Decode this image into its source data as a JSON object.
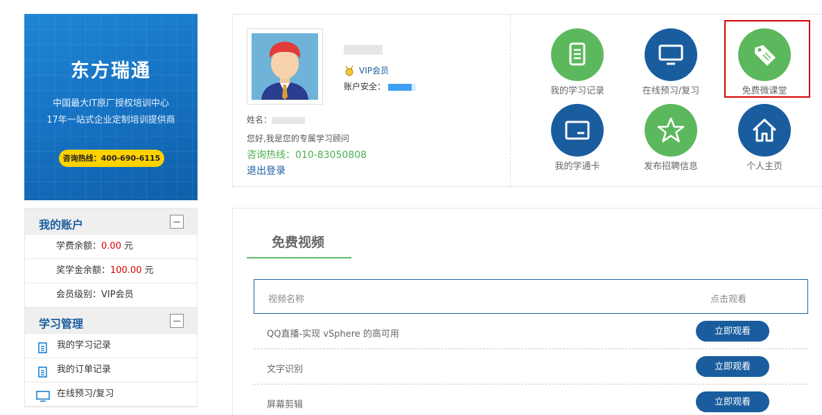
{
  "banner": {
    "title": "东方瑞通",
    "subtitle1": "中国最大IT原厂授权培训中心",
    "subtitle2": "17年一站式企业定制培训提供商",
    "hotline": "咨询热线：400-690-6115"
  },
  "account": {
    "title": "我的账户",
    "items": [
      {
        "label": "学费余额：",
        "value": "0.00",
        "unit": " 元"
      },
      {
        "label": "奖学金余额：",
        "value": "100.00",
        "unit": " 元"
      },
      {
        "label": "会员级别：VIP会员"
      }
    ]
  },
  "study": {
    "title": "学习管理",
    "items": [
      {
        "label": "我的学习记录",
        "icon": "document-icon"
      },
      {
        "label": "我的订单记录",
        "icon": "document-icon"
      },
      {
        "label": "在线预习/复习",
        "icon": "monitor-icon"
      }
    ]
  },
  "profile": {
    "vip_label": "VIP会员",
    "security_label": "账户安全：",
    "name_label": "姓名：",
    "advisor_text": "您好,我是您的专属学习顾问",
    "hotline": "咨询热线：010-83050808",
    "logout": "退出登录"
  },
  "quick_links": [
    {
      "label": "我的学习记录",
      "icon": "document-icon",
      "color": "#5cb85c"
    },
    {
      "label": "在线预习/复习",
      "icon": "monitor-icon",
      "color": "#1a5d9e"
    },
    {
      "label": "免费微课堂",
      "icon": "tag-icon",
      "color": "#5cb85c"
    },
    {
      "label": "我的学通卡",
      "icon": "card-icon",
      "color": "#1a5d9e"
    },
    {
      "label": "发布招聘信息",
      "icon": "star-icon",
      "color": "#5cb85c"
    },
    {
      "label": "个人主页",
      "icon": "home-icon",
      "color": "#1a5d9e"
    }
  ],
  "videos": {
    "tab_title": "免费视频",
    "columns": [
      "视频名称",
      "点击观看"
    ],
    "watch_label": "立即观看",
    "rows": [
      {
        "name": "QQ直播-实现 vSphere 的高可用"
      },
      {
        "name": "文字识别"
      },
      {
        "name": "屏幕剪辑"
      }
    ]
  }
}
